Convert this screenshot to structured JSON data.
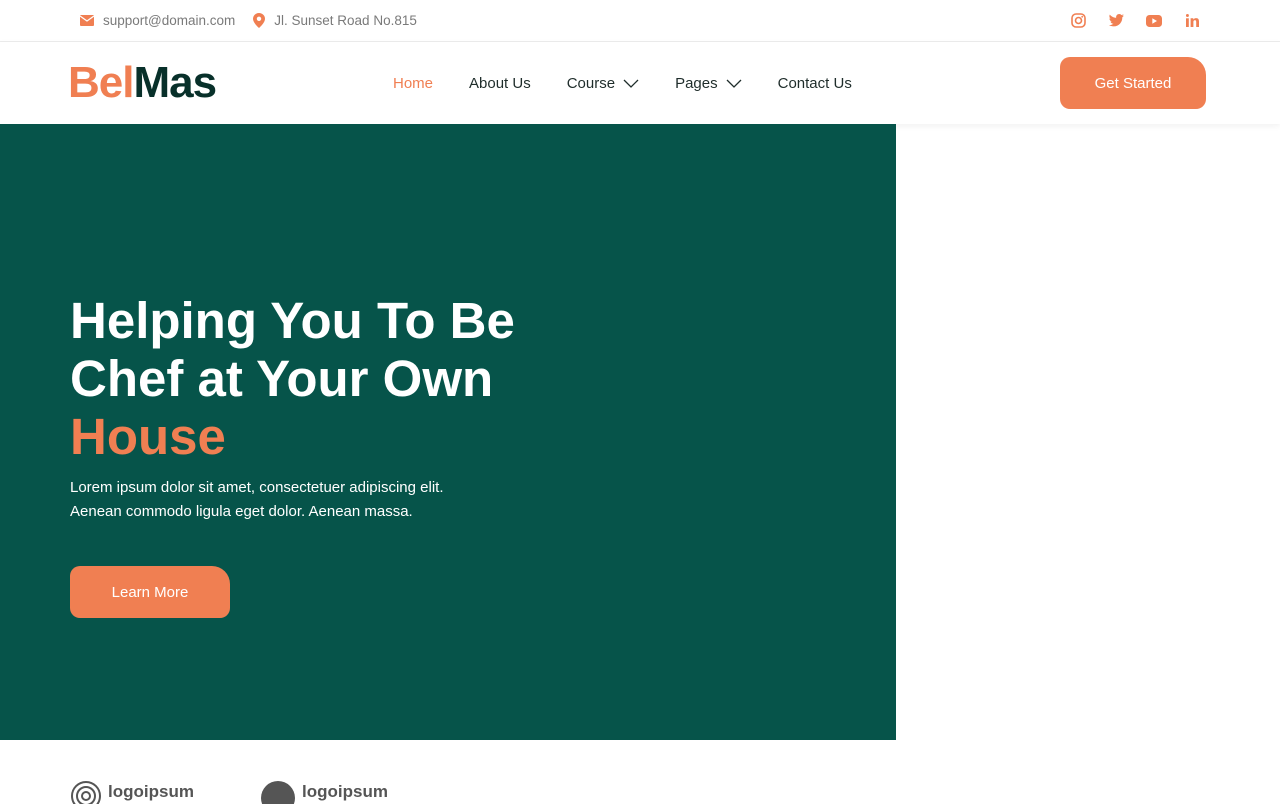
{
  "topbar": {
    "email": "support@domain.com",
    "address": "Jl. Sunset Road No.815",
    "social_icons": [
      "instagram-icon",
      "twitter-icon",
      "youtube-icon",
      "linkedin-icon"
    ]
  },
  "brand": {
    "part1": "Bel",
    "part2": "Mas"
  },
  "nav": {
    "items": [
      {
        "label": "Home",
        "active": true
      },
      {
        "label": "About Us"
      },
      {
        "label": "Course",
        "dropdown": true
      },
      {
        "label": "Pages",
        "dropdown": true
      },
      {
        "label": "Contact Us"
      }
    ],
    "cta": "Get Started"
  },
  "hero": {
    "title_line1": "Helping You To Be",
    "title_line2": "Chef at Your Own",
    "title_accent": "House",
    "body_line1": "Lorem ipsum dolor sit amet, consectetuer adipiscing elit.",
    "body_line2": "Aenean commodo ligula eget dolor. Aenean massa.",
    "button": "Learn More"
  },
  "partners": [
    "logoipsum",
    "logoipsum"
  ],
  "colors": {
    "accent": "#f07f52",
    "hero_bg": "#06544a",
    "logo_dark": "#08302a"
  }
}
